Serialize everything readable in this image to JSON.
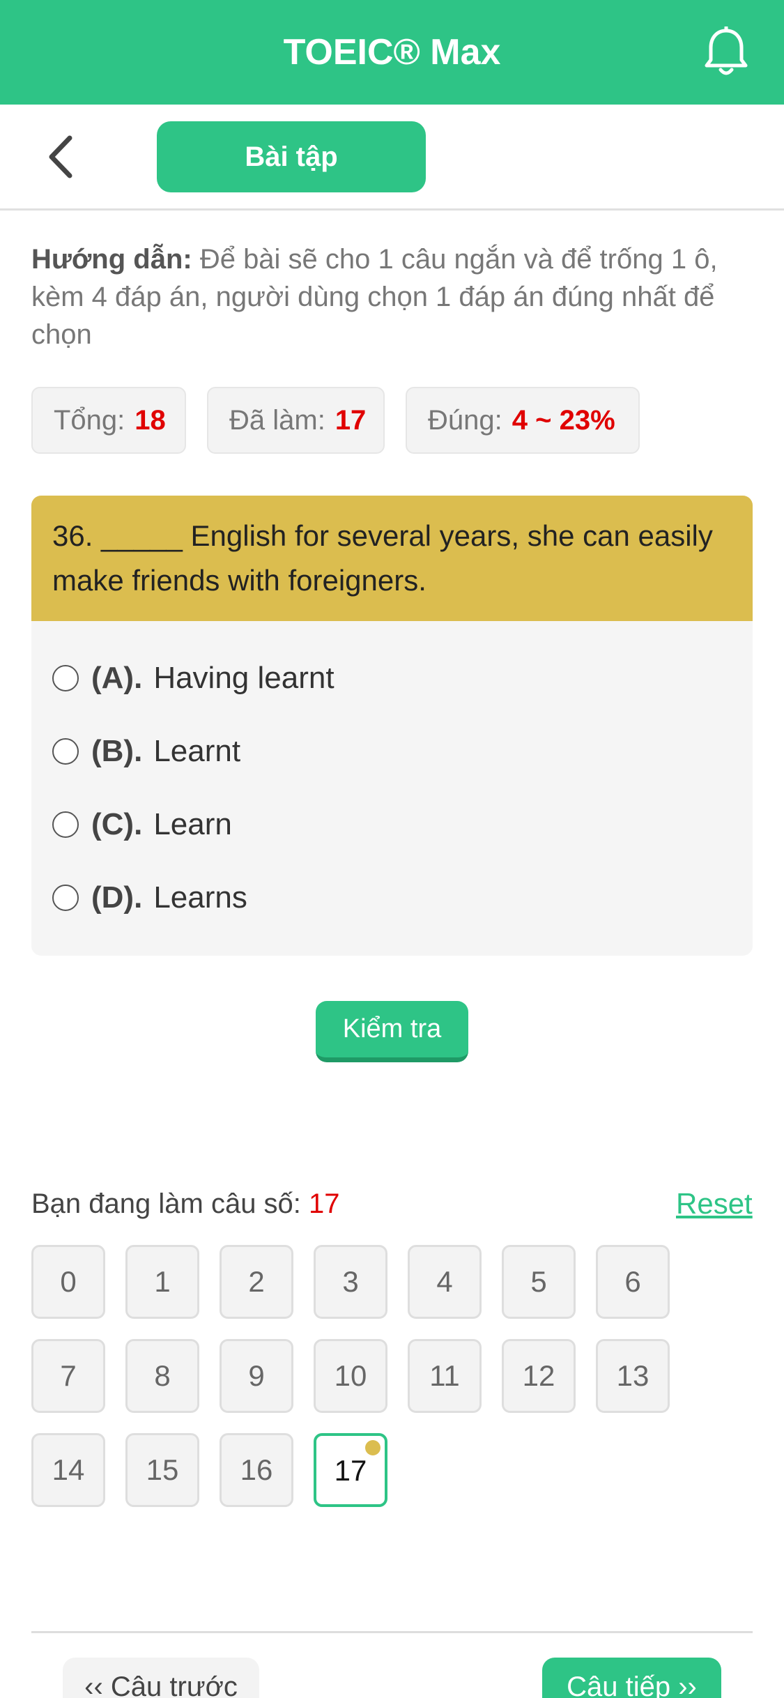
{
  "header": {
    "title": "TOEIC® Max",
    "bell_icon": "bell-icon"
  },
  "subbar": {
    "back_icon": "chevron-left-icon",
    "tab_label": "Bài tập"
  },
  "instructions": {
    "label": "Hướng dẫn:",
    "text": " Để bài sẽ cho 1 câu ngắn và để trống 1 ô, kèm 4 đáp án, người dùng chọn 1 đáp án đúng nhất để chọn"
  },
  "stats": {
    "total_label": "Tổng:",
    "total_value": "18",
    "done_label": "Đã làm:",
    "done_value": "17",
    "correct_label": "Đúng:",
    "correct_value": "4 ~ 23%"
  },
  "question": {
    "text": "36. _____ English for several years, she can easily make friends with foreigners.",
    "options": [
      {
        "label": "(A).",
        "text": "Having learnt"
      },
      {
        "label": "(B).",
        "text": "Learnt"
      },
      {
        "label": "(C).",
        "text": "Learn"
      },
      {
        "label": "(D).",
        "text": "Learns"
      }
    ]
  },
  "check_button": "Kiểm tra",
  "progress": {
    "label": "Bạn đang làm câu số:",
    "current": "17",
    "reset": "Reset"
  },
  "question_numbers": [
    "0",
    "1",
    "2",
    "3",
    "4",
    "5",
    "6",
    "7",
    "8",
    "9",
    "10",
    "11",
    "12",
    "13",
    "14",
    "15",
    "16",
    "17"
  ],
  "active_question": "17",
  "nav": {
    "prev": "‹‹ Câu trước",
    "next": "Câu tiếp ››"
  },
  "colors": {
    "brand_green": "#2ec486",
    "question_header": "#dbbd4f",
    "highlight_red": "#e00000"
  }
}
